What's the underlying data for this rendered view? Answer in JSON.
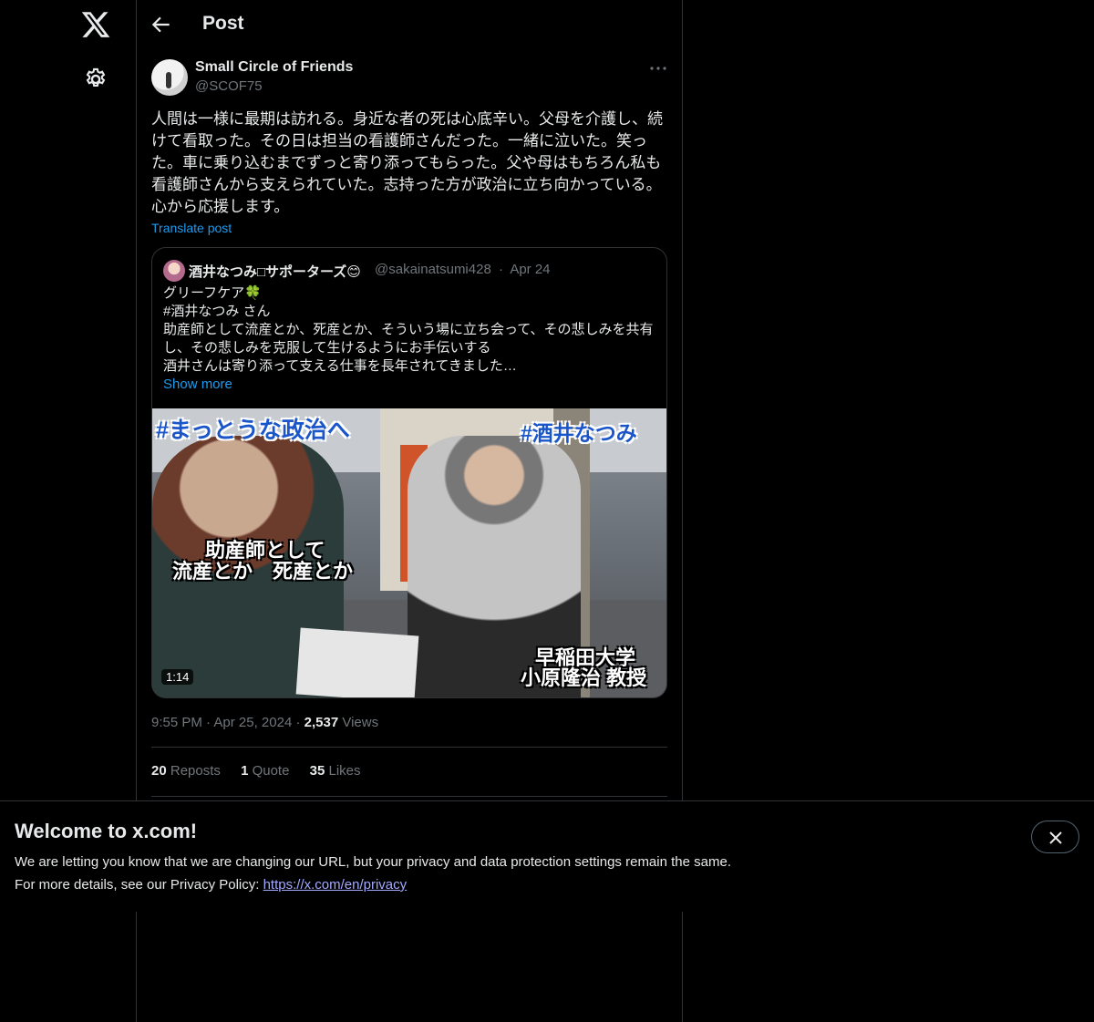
{
  "header": {
    "title": "Post"
  },
  "post": {
    "author_name": "Small Circle of Friends",
    "author_handle": "@SCOF75",
    "text": "人間は一様に最期は訪れる。身近な者の死は心底辛い。父母を介護し、続けて看取った。その日は担当の看護師さんだった。一緒に泣いた。笑った。車に乗り込むまでずっと寄り添ってもらった。父や母はもちろん私も看護師さんから支えられていた。志持った方が政治に立ち向かっている。心から応援します。",
    "translate_label": "Translate post",
    "time": "9:55 PM",
    "date": "Apr 25, 2024",
    "views_count": "2,537",
    "views_label": "Views"
  },
  "quote": {
    "name": "酒井なつみ□サポーターズ😊",
    "handle": "@sakainatsumi428",
    "separator": "·",
    "date": "Apr 24",
    "lines": [
      "グリーフケア🍀",
      "#酒井なつみ さん",
      "助産師として流産とか、死産とか、そういう場に立ち会って、その悲しみを共有し、その悲しみを克服して生けるようにお手伝いする",
      "酒井さんは寄り添って支える仕事を長年されてきました…"
    ],
    "show_more": "Show more",
    "media": {
      "overlay_top_left": "#まっとうな政治へ",
      "overlay_top_right": "#酒井なつみ",
      "caption_left_1": "助産師として",
      "caption_left_2": "流産とか　死産とか",
      "caption_right_1": "早稲田大学",
      "caption_right_2": "小原隆治 教授",
      "duration": "1:14"
    }
  },
  "stats": {
    "reposts_count": "20",
    "reposts_label": "Reposts",
    "quotes_count": "1",
    "quotes_label": "Quote",
    "likes_count": "35",
    "likes_label": "Likes"
  },
  "banner": {
    "title": "Welcome to x.com!",
    "line1": "We are letting you know that we are changing our URL, but your privacy and data protection settings remain the same.",
    "line2_prefix": "For more details, see our Privacy Policy: ",
    "link": "https://x.com/en/privacy"
  },
  "icons": {
    "logo": "x-logo-icon",
    "settings": "gear-icon",
    "back": "arrow-left-icon",
    "more": "more-horizontal-icon",
    "close": "close-icon"
  },
  "colors": {
    "background": "#000000",
    "text": "#e7e9ea",
    "muted": "#71767b",
    "accent": "#1d9bf0",
    "border": "#2f3336"
  }
}
